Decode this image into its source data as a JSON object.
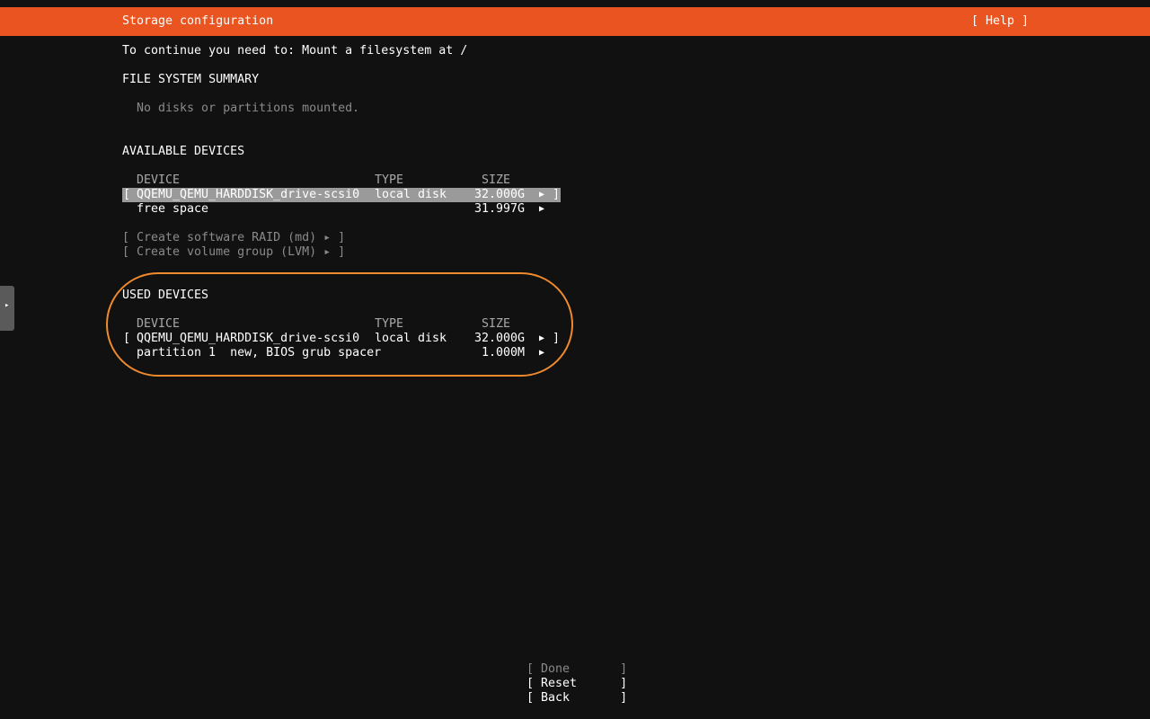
{
  "header": {
    "title": "Storage configuration",
    "help_label": "[ Help ]"
  },
  "instruction": "To continue you need to: Mount a filesystem at /",
  "filesystem_summary": {
    "heading": "FILE SYSTEM SUMMARY",
    "empty_text": "No disks or partitions mounted."
  },
  "available_devices": {
    "heading": "AVAILABLE DEVICES",
    "columns": {
      "device": "DEVICE",
      "type": "TYPE",
      "size": "SIZE"
    },
    "rows": [
      {
        "open": "[",
        "device": "QQEMU_QEMU_HARDDISK_drive-scsi0",
        "type": "local disk",
        "size": "32.000G",
        "arrow": "▶",
        "close": "]"
      },
      {
        "device": "free space",
        "type": "",
        "size": "31.997G",
        "arrow": "▶"
      }
    ],
    "actions": [
      {
        "label": "[ Create software RAID (md) ▸ ]"
      },
      {
        "label": "[ Create volume group (LVM) ▸ ]"
      }
    ]
  },
  "used_devices": {
    "heading": "USED DEVICES",
    "columns": {
      "device": "DEVICE",
      "type": "TYPE",
      "size": "SIZE"
    },
    "rows": [
      {
        "open": "[",
        "device": "QQEMU_QEMU_HARDDISK_drive-scsi0",
        "type": "local disk",
        "size": "32.000G",
        "arrow": "▶",
        "close": "]"
      },
      {
        "device": "partition 1  new, BIOS grub spacer",
        "size": "1.000M",
        "arrow": "▶"
      }
    ]
  },
  "footer_buttons": [
    {
      "label": "[ Done       ]",
      "enabled": false
    },
    {
      "label": "[ Reset      ]",
      "enabled": true
    },
    {
      "label": "[ Back       ]",
      "enabled": true
    }
  ],
  "side_tab_icon": "▸",
  "colors": {
    "accent": "#e95420",
    "background": "#111111",
    "selection": "#9a9a9a",
    "annotation_ring": "#f08a2c",
    "disabled_text": "#8a8a8a"
  }
}
